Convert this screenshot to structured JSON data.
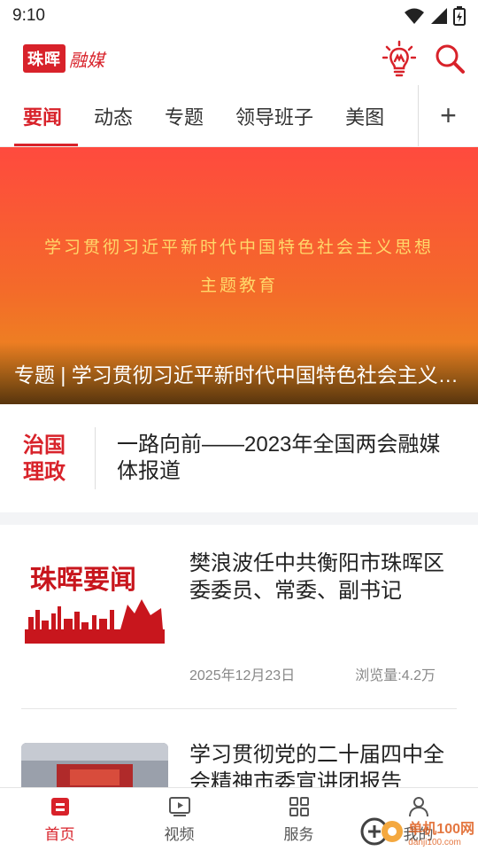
{
  "status_bar": {
    "time": "9:10"
  },
  "header": {
    "logo_box": "珠晖",
    "logo_tail": "融媒",
    "icons": [
      "idea-bulb-icon",
      "search-icon"
    ]
  },
  "tabs": {
    "items": [
      {
        "label": "要闻",
        "active": true
      },
      {
        "label": "动态",
        "active": false
      },
      {
        "label": "专题",
        "active": false
      },
      {
        "label": "领导班子",
        "active": false
      },
      {
        "label": "美图",
        "active": false
      }
    ],
    "add_label": "+"
  },
  "banner": {
    "line1": "学习贯彻习近平新时代中国特色社会主义思想",
    "line2": "主题教育",
    "caption": "专题 | 学习贯彻习近平新时代中国特色社会主义思想主题教育"
  },
  "feature": {
    "badge_line1": "治国",
    "badge_line2": "理政",
    "title": "一路向前——2023年全国两会融媒体报道"
  },
  "news": [
    {
      "thumb_text": "珠晖要闻",
      "title": "樊浪波任中共衡阳市珠晖区委委员、常委、副书记",
      "date": "2025年12月23日",
      "views": "浏览量:4.2万"
    },
    {
      "title": "学习贯彻党的二十届四中全会精神市委宣讲团报告"
    }
  ],
  "bottom_nav": {
    "items": [
      {
        "label": "首页",
        "icon": "home-icon",
        "active": true
      },
      {
        "label": "视频",
        "icon": "video-icon",
        "active": false
      },
      {
        "label": "服务",
        "icon": "grid-icon",
        "active": false
      },
      {
        "label": "我的",
        "icon": "user-icon",
        "active": false
      }
    ]
  },
  "watermark": {
    "main": "单机100网",
    "sub": "danji100.com"
  },
  "colors": {
    "accent": "#d8222a",
    "banner_top": "#ff4a3e",
    "banner_bottom": "#e7941a",
    "banner_text": "#ffd86a"
  }
}
